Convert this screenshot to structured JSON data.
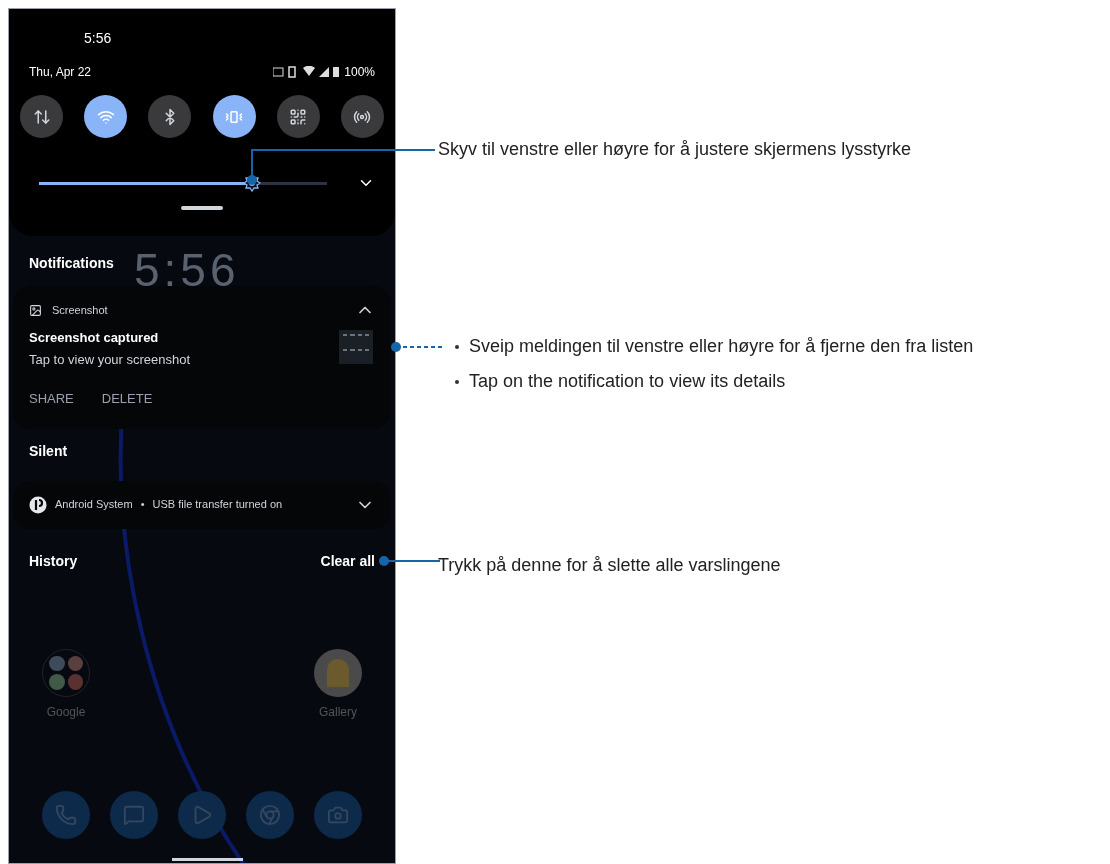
{
  "status_bar": {
    "time": "5:56",
    "date": "Thu, Apr 22",
    "battery": "100%"
  },
  "quick_tiles": [
    {
      "kind": "data",
      "on": false
    },
    {
      "kind": "wifi",
      "on": true
    },
    {
      "kind": "bluetooth",
      "on": false
    },
    {
      "kind": "vibrate",
      "on": true
    },
    {
      "kind": "qr",
      "on": false
    },
    {
      "kind": "hotspot",
      "on": false
    }
  ],
  "brightness": {
    "level": 0.74
  },
  "lock_clock": "5:56",
  "sections": [
    {
      "kind": "header",
      "title": "Notifications"
    },
    {
      "kind": "notification",
      "app": "Screenshot",
      "expanded": true,
      "title": "Screenshot captured",
      "text": "Tap to view your screenshot",
      "actions": [
        "SHARE",
        "DELETE"
      ]
    },
    {
      "kind": "header",
      "title": "Silent"
    },
    {
      "kind": "compact",
      "app": "Android System",
      "separator": "•",
      "text": "USB file transfer turned on",
      "expanded": false
    },
    {
      "kind": "history",
      "title": "History",
      "action": "Clear all"
    }
  ],
  "home_apps": [
    {
      "label": "Google",
      "kind": "folder"
    },
    {
      "label": "Gallery",
      "kind": "gallery"
    }
  ],
  "dock": [
    {
      "kind": "phone"
    },
    {
      "kind": "messages"
    },
    {
      "kind": "play"
    },
    {
      "kind": "browser"
    },
    {
      "kind": "camera"
    }
  ],
  "callouts": [
    {
      "kind": "brightness",
      "lines": [
        "Skyv til venstre eller høyre for å justere skjermens lysstyrke"
      ]
    },
    {
      "kind": "notification",
      "lines": [
        "Sveip meldingen til venstre eller høyre for å fjerne den fra listen",
        "Tap on the notification to view its details"
      ]
    },
    {
      "kind": "clear_all",
      "lines": [
        "Trykk på denne for å slette alle varslingene"
      ]
    }
  ]
}
